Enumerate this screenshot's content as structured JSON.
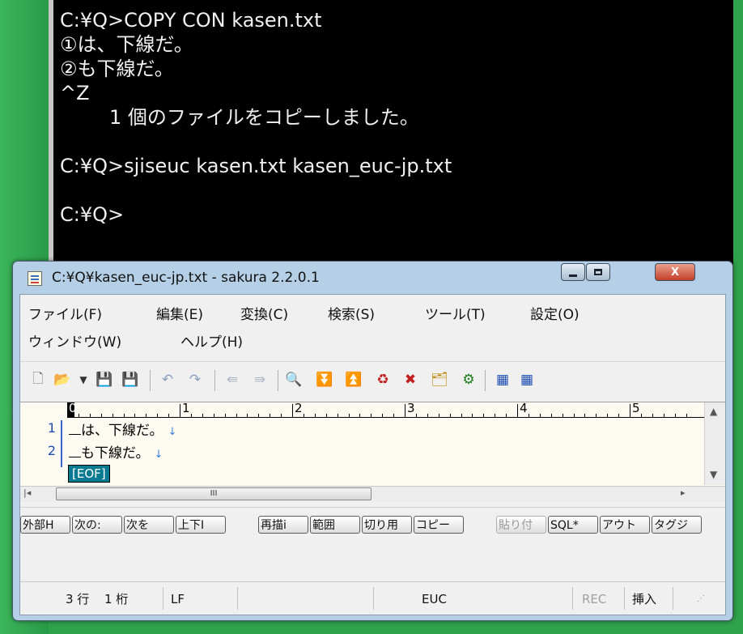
{
  "console": {
    "lines": [
      "C:¥Q>COPY CON kasen.txt",
      "①は、下線だ。",
      "②も下線だ。",
      "^Z",
      "        1 個のファイルをコピーしました。",
      "",
      "C:¥Q>sjiseuc kasen.txt kasen_euc-jp.txt",
      "",
      "C:¥Q>"
    ]
  },
  "window": {
    "title": "C:¥Q¥kasen_euc-jp.txt - sakura 2.2.0.1",
    "close_label": "X"
  },
  "menu": {
    "row1": [
      "ファイル(F)",
      "編集(E)",
      "変換(C)",
      "検索(S)",
      "ツール(T)",
      "設定(O)"
    ],
    "row2": [
      "ウィンドウ(W)",
      "ヘルプ(H)"
    ]
  },
  "ruler": {
    "labels": [
      "0",
      "1",
      "2",
      "3",
      "4",
      "5"
    ]
  },
  "editor": {
    "lines": [
      {
        "num": "1",
        "text": "は、下線だ。",
        "eol": "↓"
      },
      {
        "num": "2",
        "text": "も下線だ。",
        "eol": "↓"
      }
    ],
    "eof": "[EOF]"
  },
  "hscroll": {
    "thumb_grip": "III"
  },
  "function_keys": [
    {
      "label": "外部H",
      "enabled": true
    },
    {
      "label": "次の:",
      "enabled": true
    },
    {
      "label": "次を",
      "enabled": true
    },
    {
      "label": "上下I",
      "enabled": true
    },
    {
      "label": "再描i",
      "enabled": true
    },
    {
      "label": "範囲",
      "enabled": true
    },
    {
      "label": "切り用",
      "enabled": true
    },
    {
      "label": "コピー",
      "enabled": true
    },
    {
      "label": "貼り付",
      "enabled": false
    },
    {
      "label": "SQL*",
      "enabled": true
    },
    {
      "label": "アウト",
      "enabled": true
    },
    {
      "label": "タグジ",
      "enabled": true
    }
  ],
  "status": {
    "line": "3 行",
    "col": "1 桁",
    "eol": "LF",
    "encoding": "EUC",
    "rec": "REC",
    "mode": "挿入"
  },
  "colors": {
    "console_bg": "#000000",
    "desktop": "#2fa24c",
    "editor_bg": "#fdfbf1",
    "line_number": "#1d4db0",
    "eof_bg": "#0a7a93"
  }
}
